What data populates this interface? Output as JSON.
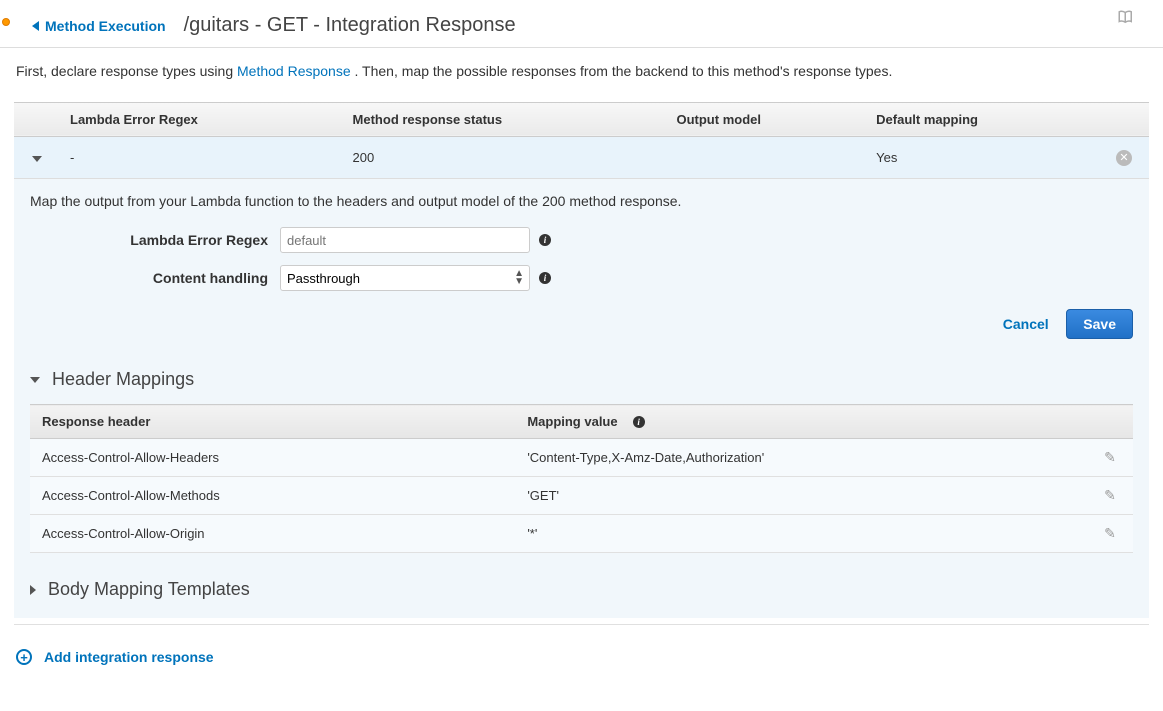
{
  "nav": {
    "back_label": "Method Execution",
    "page_title": "/guitars - GET - Integration Response"
  },
  "intro": {
    "prefix": "First, declare response types using ",
    "link": "Method Response",
    "suffix": ". Then, map the possible responses from the backend to this method's response types."
  },
  "columns": {
    "c1": "Lambda Error Regex",
    "c2": "Method response status",
    "c3": "Output model",
    "c4": "Default mapping"
  },
  "row": {
    "regex": "-",
    "status": "200",
    "model": "",
    "default": "Yes"
  },
  "panel": {
    "sub_intro": "Map the output from your Lambda function to the headers and output model of the 200 method response.",
    "label_regex": "Lambda Error Regex",
    "placeholder_regex": "default",
    "label_content": "Content handling",
    "content_value": "Passthrough",
    "cancel": "Cancel",
    "save": "Save"
  },
  "header_mappings": {
    "title": "Header Mappings",
    "col_header": "Response header",
    "col_value": "Mapping value",
    "rows": [
      {
        "h": "Access-Control-Allow-Headers",
        "v": "'Content-Type,X-Amz-Date,Authorization'"
      },
      {
        "h": "Access-Control-Allow-Methods",
        "v": "'GET'"
      },
      {
        "h": "Access-Control-Allow-Origin",
        "v": "'*'"
      }
    ]
  },
  "body_templates_title": "Body Mapping Templates",
  "add_response": "Add integration response"
}
